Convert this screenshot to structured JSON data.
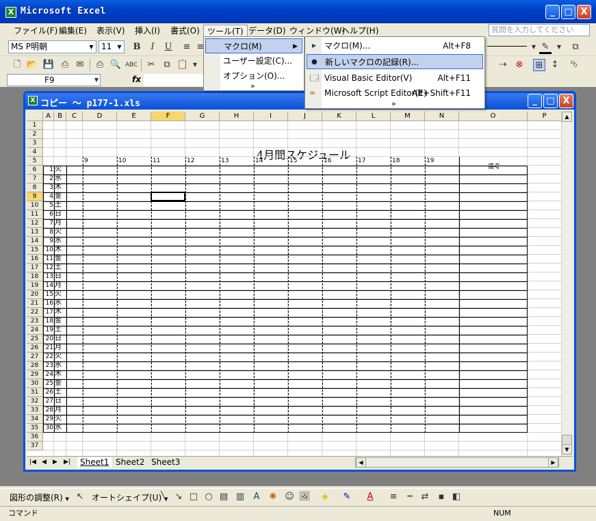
{
  "app": {
    "title": "Microsoft Excel",
    "icon_glyph": "X"
  },
  "window_controls": {
    "minimize": "_",
    "maximize": "□",
    "close": "X"
  },
  "menubar": {
    "items": [
      "ファイル(F)",
      "編集(E)",
      "表示(V)",
      "挿入(I)",
      "書式(O)",
      "ツール(T)",
      "データ(D)",
      "ウィンドウ(W)",
      "ヘルプ(H)"
    ],
    "help_placeholder": "質問を入力してください"
  },
  "format_toolbar": {
    "font_name": "MS P明朝",
    "font_size": "11"
  },
  "formula_bar": {
    "name_box": "F9",
    "fx": "fx",
    "value": ""
  },
  "workbook": {
    "title": "コピー 〜 p177-1.xls"
  },
  "sheet": {
    "columns": [
      "A",
      "B",
      "C",
      "D",
      "E",
      "F",
      "G",
      "H",
      "I",
      "J",
      "K",
      "L",
      "M",
      "N",
      "O",
      "P"
    ],
    "rows": [
      "1",
      "2",
      "3",
      "4",
      "5",
      "6",
      "7",
      "8",
      "9",
      "10",
      "11",
      "12",
      "13",
      "14",
      "15",
      "16",
      "17",
      "18",
      "19",
      "20",
      "21",
      "22",
      "23",
      "24",
      "25",
      "26",
      "27",
      "28",
      "29",
      "30",
      "31",
      "32",
      "33",
      "34",
      "35",
      "36",
      "37"
    ],
    "selected_cell": "F9",
    "heading": "4月間スケジュール",
    "hours": [
      "9",
      "10",
      "11",
      "12",
      "13",
      "14",
      "15",
      "16",
      "17",
      "18",
      "19"
    ],
    "notes_header": "備考",
    "days": [
      {
        "d": "1",
        "w": "火"
      },
      {
        "d": "2",
        "w": "水"
      },
      {
        "d": "3",
        "w": "木"
      },
      {
        "d": "4",
        "w": "金"
      },
      {
        "d": "5",
        "w": "土"
      },
      {
        "d": "6",
        "w": "日"
      },
      {
        "d": "7",
        "w": "月"
      },
      {
        "d": "8",
        "w": "火"
      },
      {
        "d": "9",
        "w": "水"
      },
      {
        "d": "10",
        "w": "木"
      },
      {
        "d": "11",
        "w": "金"
      },
      {
        "d": "12",
        "w": "土"
      },
      {
        "d": "13",
        "w": "日"
      },
      {
        "d": "14",
        "w": "月"
      },
      {
        "d": "15",
        "w": "火"
      },
      {
        "d": "16",
        "w": "水"
      },
      {
        "d": "17",
        "w": "木"
      },
      {
        "d": "18",
        "w": "金"
      },
      {
        "d": "19",
        "w": "土"
      },
      {
        "d": "20",
        "w": "日"
      },
      {
        "d": "21",
        "w": "月"
      },
      {
        "d": "22",
        "w": "火"
      },
      {
        "d": "23",
        "w": "水"
      },
      {
        "d": "24",
        "w": "木"
      },
      {
        "d": "25",
        "w": "金"
      },
      {
        "d": "26",
        "w": "土"
      },
      {
        "d": "27",
        "w": "日"
      },
      {
        "d": "28",
        "w": "月"
      },
      {
        "d": "29",
        "w": "火"
      },
      {
        "d": "30",
        "w": "水"
      }
    ],
    "tabs": [
      "Sheet1",
      "Sheet2",
      "Sheet3"
    ],
    "active_tab": "Sheet1"
  },
  "tools_menu": {
    "items": [
      {
        "label": "マクロ(M)",
        "has_submenu": true
      },
      {
        "label": "ユーザー設定(C)..."
      },
      {
        "label": "オプション(O)..."
      }
    ],
    "expand": "»"
  },
  "macro_menu": {
    "items": [
      {
        "label": "マクロ(M)...",
        "shortcut": "Alt+F8"
      },
      {
        "label": "新しいマクロの記録(R)...",
        "shortcut": ""
      },
      {
        "label": "Visual Basic Editor(V)",
        "shortcut": "Alt+F11"
      },
      {
        "label": "Microsoft Script Editor(E)",
        "shortcut": "Alt+Shift+F11"
      }
    ],
    "expand": "»"
  },
  "drawing_toolbar": {
    "draw_label": "図形の調整(R)",
    "autoshape_label": "オートシェイプ(U)"
  },
  "status": {
    "mode": "コマンド",
    "num": "NUM"
  },
  "colors": {
    "selection": "#C1D2EE",
    "title_blue": "#0050E0",
    "header_sel": "#F9D66E"
  }
}
